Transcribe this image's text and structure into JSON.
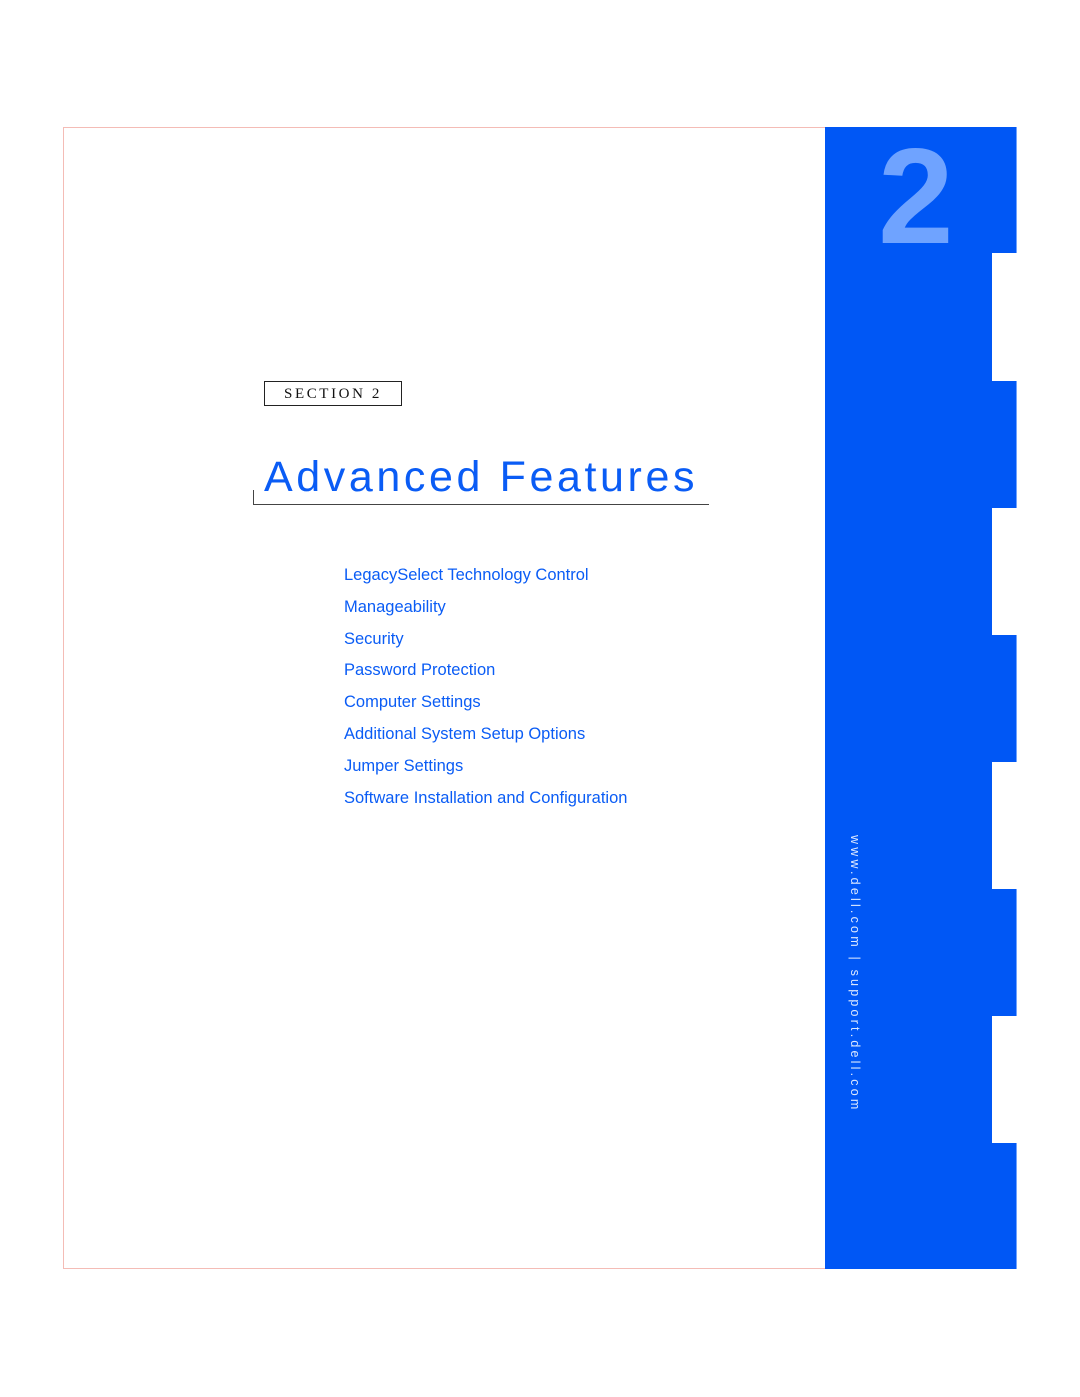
{
  "page": {
    "section_label": "SECTION 2",
    "title": "Advanced Features",
    "chapter_number": "2",
    "side_url": "www.dell.com | support.dell.com",
    "toc": [
      "LegacySelect Technology Control",
      "Manageability",
      "Security",
      "Password Protection",
      "Computer Settings",
      "Additional System Setup Options",
      "Jumper Settings",
      "Software Installation and Configuration"
    ]
  },
  "colors": {
    "brand_blue": "#0057f5",
    "chapter_number": "#6fa3ff",
    "link_blue": "#0a5cf5",
    "frame_border": "#f4bcb6"
  }
}
